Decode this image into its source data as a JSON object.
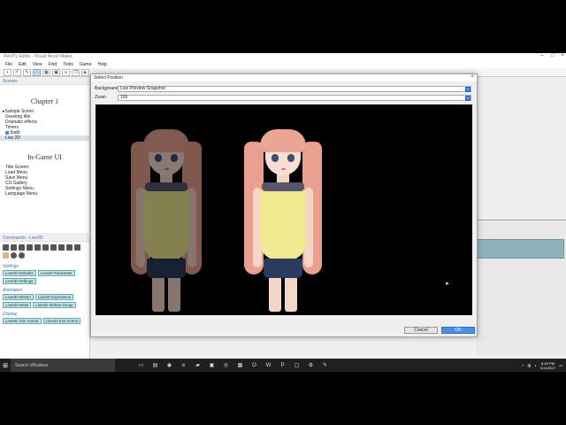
{
  "window": {
    "title": "Ren'Py Editor - Visual Novel Maker"
  },
  "menu": [
    "File",
    "Edit",
    "View",
    "Find",
    "Tools",
    "Game",
    "Help"
  ],
  "scenes": {
    "header": "Scenes",
    "chapter1": "Chapter 1",
    "items1": [
      "Sample Scene",
      "Greeting title",
      "Dramatic effects",
      "Timers",
      "Statb",
      "Live 2D"
    ],
    "selected_index": 5,
    "chapter2": "In-Game UI",
    "items2": [
      "Title Screen",
      "Load Menu",
      "Save Menu",
      "CG Gallery",
      "Settings Menu",
      "Language Menu"
    ]
  },
  "commands": {
    "header": "Commands - Live2D",
    "section_settings": "Settings",
    "settings_buttons": [
      "Live2D Defaults",
      "Live2D Parameter",
      "Live2D Settings"
    ],
    "section_animation": "Animation",
    "animation_buttons": [
      "Live2D Motion",
      "Live2D Expression",
      "Live2D Move",
      "Live2D Motion Group"
    ],
    "section_display": "Display",
    "display_buttons": [
      "Live2D Join Scene",
      "Live2D Exit Scene"
    ]
  },
  "dialog": {
    "title": "Select Position",
    "background_label": "Background",
    "background_value": "Live Preview Snapshot",
    "zoom_label": "Zoom",
    "zoom_value": "100",
    "cancel_label": "Cancel",
    "ok_label": "OK"
  },
  "taskbar": {
    "search_placeholder": "Search Windows",
    "time": "6:00 PM",
    "date": "11/2/2017"
  },
  "colors": {
    "accent": "#4a90e2",
    "command_button": "#c9e8ec",
    "dress": "#f2ea91",
    "hair": "#e9a08f"
  }
}
